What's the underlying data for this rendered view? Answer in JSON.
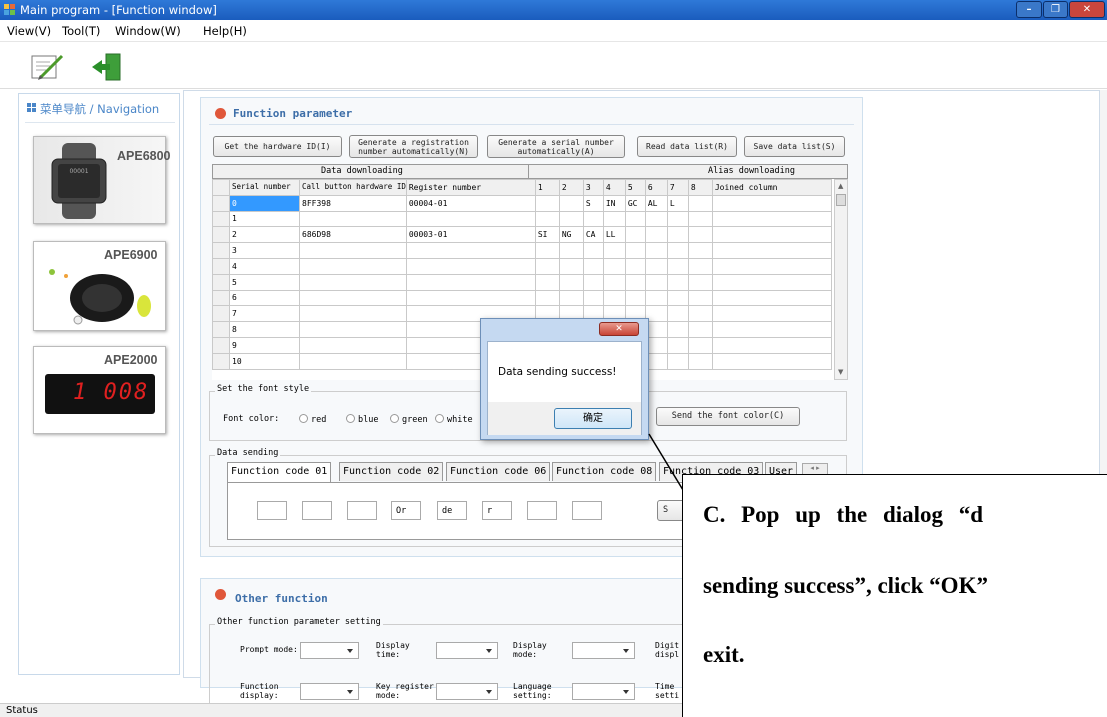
{
  "window": {
    "title": "Main program - [Function window]"
  },
  "menu": [
    "View(V)",
    "Tool(T)",
    "Window(W)",
    "Help(H)"
  ],
  "toolbar": {
    "icons": [
      "edit-icon",
      "exit-door-icon"
    ]
  },
  "nav": {
    "title": "菜单导航 / Navigation",
    "items": [
      {
        "label": "APE6800",
        "screen_text": "00001"
      },
      {
        "label": "APE6900"
      },
      {
        "label": "APE2000",
        "display_text": "1 008"
      }
    ]
  },
  "function_panel": {
    "title": "Function parameter",
    "buttons": [
      "Get the hardware ID(I)",
      "Generate a registration number automatically(N)",
      "Generate a serial number automatically(A)",
      "Read data list(R)",
      "Save data list(S)"
    ],
    "table": {
      "group_headers": [
        "Data downloading",
        "Alias downloading"
      ],
      "columns": [
        "Serial number",
        "Call button hardware ID",
        "Register number",
        "1",
        "2",
        "3",
        "4",
        "5",
        "6",
        "7",
        "8",
        "Joined column"
      ],
      "rows": [
        [
          "0",
          "8FF398",
          "00004-01",
          "",
          "",
          "S",
          "IN",
          "GC",
          "AL",
          "L",
          "",
          ""
        ],
        [
          "1",
          "",
          "",
          "",
          "",
          "",
          "",
          "",
          "",
          "",
          "",
          ""
        ],
        [
          "2",
          "686D98",
          "00003-01",
          "SI",
          "NG",
          "CA",
          "LL",
          "",
          "",
          "",
          "",
          ""
        ],
        [
          "3",
          "",
          "",
          "",
          "",
          "",
          "",
          "",
          "",
          "",
          "",
          ""
        ],
        [
          "4",
          "",
          "",
          "",
          "",
          "",
          "",
          "",
          "",
          "",
          "",
          ""
        ],
        [
          "5",
          "",
          "",
          "",
          "",
          "",
          "",
          "",
          "",
          "",
          "",
          ""
        ],
        [
          "6",
          "",
          "",
          "",
          "",
          "",
          "",
          "",
          "",
          "",
          "",
          ""
        ],
        [
          "7",
          "",
          "",
          "",
          "",
          "",
          "",
          "",
          "",
          "",
          "",
          ""
        ],
        [
          "8",
          "",
          "",
          "",
          "",
          "",
          "",
          "",
          "",
          "",
          "",
          ""
        ],
        [
          "9",
          "",
          "",
          "",
          "",
          "",
          "",
          "",
          "",
          "",
          "",
          ""
        ],
        [
          "10",
          "",
          "",
          "",
          "",
          "",
          "",
          "",
          "",
          "",
          "",
          ""
        ]
      ]
    },
    "font_style": {
      "group_title": "Set the font style",
      "label": "Font color:",
      "options": [
        "red",
        "blue",
        "green",
        "white"
      ],
      "send_button": "Send the font color(C)"
    },
    "data_sending": {
      "group_title": "Data sending",
      "tabs": [
        "Function code 01",
        "Function code 02",
        "Function code 06",
        "Function code 08",
        "Function code 03",
        "User"
      ],
      "inputs": [
        "",
        "",
        "",
        "Or",
        "de",
        "r",
        "",
        ""
      ],
      "send_button_partial": "S"
    }
  },
  "other_panel": {
    "title": "Other function",
    "group_title": "Other function parameter setting",
    "fields": [
      {
        "label": "Prompt mode:"
      },
      {
        "label": "Display time:"
      },
      {
        "label": "Display mode:"
      },
      {
        "label": "Digit displ"
      },
      {
        "label": "Function display:"
      },
      {
        "label": "Key register mode:"
      },
      {
        "label": "Language setting:"
      },
      {
        "label": "Time setti"
      }
    ]
  },
  "dialog": {
    "message": "Data sending success!",
    "ok_button": "确定",
    "close_icon": "close-icon"
  },
  "annotation": {
    "lines": [
      "C. Pop up the dialog “d",
      "sending success”, click “OK”",
      "exit."
    ]
  },
  "status": {
    "text": "Status"
  },
  "colors": {
    "titlebar": "#2166c9",
    "accent_red": "#e0573a",
    "panel_title": "#3d6ea8",
    "nav_title": "#4a86c8"
  }
}
